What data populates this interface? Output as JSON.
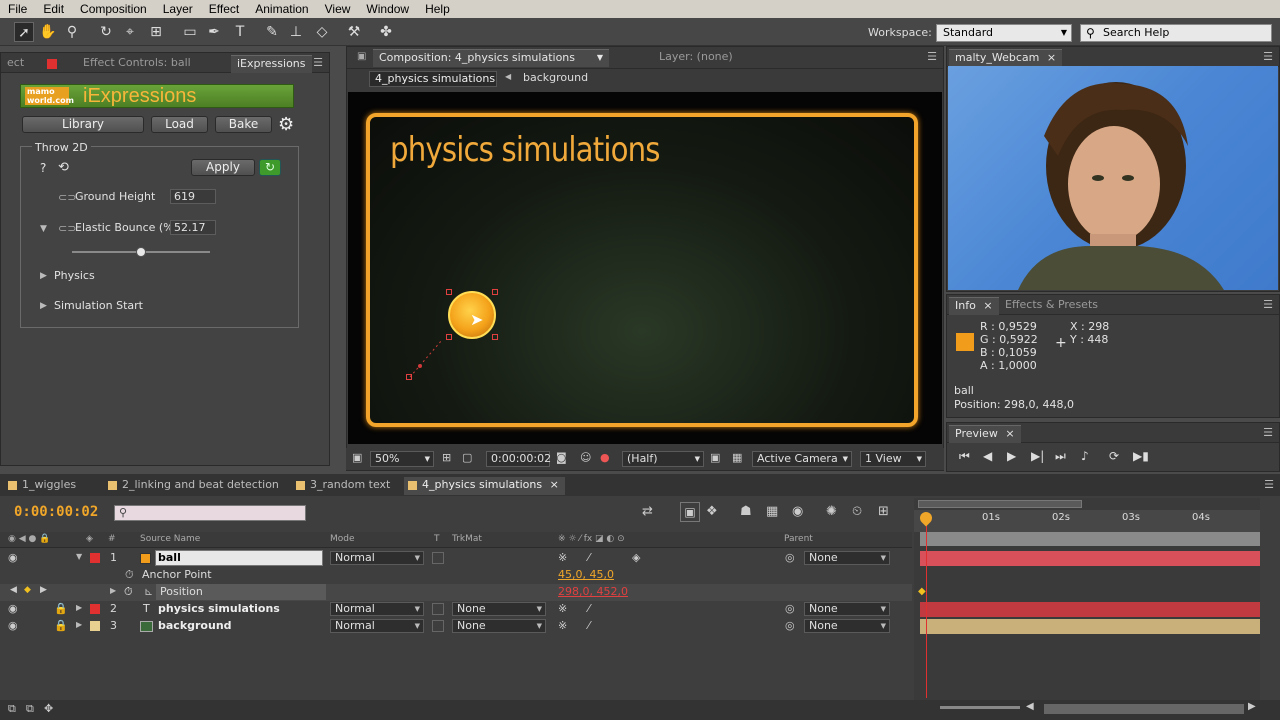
{
  "menu": [
    "File",
    "Edit",
    "Composition",
    "Layer",
    "Effect",
    "Animation",
    "View",
    "Window",
    "Help"
  ],
  "toolbar": {
    "workspace_label": "Workspace:",
    "workspace_value": "Standard",
    "search_placeholder": "Search Help"
  },
  "effect_panel": {
    "tab_ect": "ect",
    "tab_effect_controls": "Effect Controls: ball",
    "tab_iexpressions": "iExpressions",
    "logo_brand": "mamo world.com",
    "logo_title": "iExpressions",
    "buttons": {
      "library": "Library",
      "load": "Load",
      "bake": "Bake",
      "apply": "Apply"
    },
    "group_title": "Throw 2D",
    "question": "?",
    "ground_height_label": "Ground Height",
    "ground_height_value": "619",
    "elastic_label": "Elastic Bounce (%)",
    "elastic_value": "52.17",
    "elastic_slider_fraction": 0.5,
    "physics_label": "Physics",
    "simulation_start_label": "Simulation Start"
  },
  "comp_panel": {
    "tab_comp": "Composition: 4_physics simulations",
    "tab_layer": "Layer: (none)",
    "breadcrumb_active": "4_physics simulations",
    "breadcrumb_next": "background",
    "comp_title": "physics simulations",
    "zoom": "50%",
    "timecode": "0:00:00:02",
    "resolution": "(Half)",
    "camera": "Active Camera",
    "view": "1 View"
  },
  "webcam_panel": {
    "tab": "malty_Webcam"
  },
  "info_panel": {
    "tab_info": "Info",
    "tab_effects": "Effects & Presets",
    "swatch_color": "#f29c1b",
    "r": "R : 0,9529",
    "g": "G : 0,5922",
    "b": "B : 0,1059",
    "a": "A : 1,0000",
    "x": "X : 298",
    "y": "Y : 448",
    "layer_name": "ball",
    "position": "Position: 298,0, 448,0"
  },
  "preview_panel": {
    "tab": "Preview"
  },
  "timeline": {
    "tabs": [
      "1_wiggles",
      "2_linking and beat detection",
      "3_random text",
      "4_physics simulations"
    ],
    "timecode": "0:00:00:02",
    "columns": {
      "source_name": "Source Name",
      "mode": "Mode",
      "t": "T",
      "trkmat": "TrkMat",
      "parent": "Parent",
      "num": "#"
    },
    "ruler_ticks": [
      "01s",
      "02s",
      "03s",
      "04s"
    ],
    "layers": [
      {
        "num": "1",
        "name": "ball",
        "mode": "Normal",
        "trkmat": "",
        "parent": "None",
        "label_color": "#e03030"
      },
      {
        "num": "2",
        "name": "physics simulations",
        "mode": "Normal",
        "trkmat": "None",
        "parent": "None",
        "label_color": "#e03030"
      },
      {
        "num": "3",
        "name": "background",
        "mode": "Normal",
        "trkmat": "None",
        "parent": "None",
        "label_color": "#e8d090"
      }
    ],
    "anchor_label": "Anchor Point",
    "anchor_value": "45,0, 45,0",
    "position_label": "Position",
    "position_value": "298,0, 452,0",
    "t_icon": "T"
  }
}
